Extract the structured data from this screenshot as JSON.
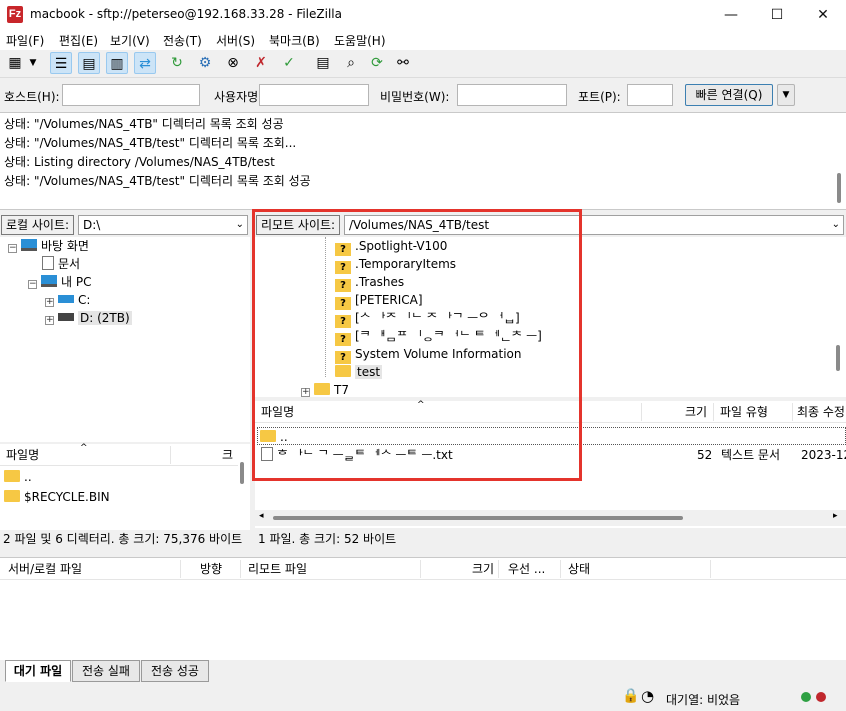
{
  "window": {
    "app_icon_text": "Fz",
    "title": "macbook - sftp://peterseo@192.168.33.28 - FileZilla",
    "minimize": "—",
    "maximize": "☐",
    "close": "✕"
  },
  "menu": [
    "파일(F)",
    "편집(E)",
    "보기(V)",
    "전송(T)",
    "서버(S)",
    "북마크(B)",
    "도움말(H)"
  ],
  "toolbar_icons": [
    "site-manager-icon",
    "dropdown-icon",
    "toggle-log-icon",
    "toggle-local-tree-icon",
    "toggle-remote-tree-icon",
    "toggle-queue-icon",
    "refresh-icon",
    "process-queue-icon",
    "cancel-icon",
    "disconnect-icon",
    "reconnect-icon",
    "filter-icon",
    "search-files-icon",
    "sync-browse-icon",
    "compare-icon"
  ],
  "quickconnect": {
    "host_label": "호스트(H):",
    "user_label": "사용자명(U):",
    "pass_label": "비밀번호(W):",
    "port_label": "포트(P):",
    "connect_button": "빠른 연결(Q)",
    "host_value": "",
    "user_value": "",
    "pass_value": "",
    "port_value": ""
  },
  "log": [
    "상태: \"/Volumes/NAS_4TB\" 디렉터리 목록 조회 성공",
    "상태: \"/Volumes/NAS_4TB/test\" 디렉터리 목록 조회...",
    "상태: Listing directory /Volumes/NAS_4TB/test",
    "상태: \"/Volumes/NAS_4TB/test\" 디렉터리 목록 조회 성공"
  ],
  "local": {
    "site_label": "로컬 사이트:",
    "path": "D:\\",
    "tree": {
      "desktop": "바탕 화면",
      "documents": "문서",
      "mypc": "내 PC",
      "c": "C:",
      "d": "D: (2TB)"
    },
    "col_name": "파일명",
    "col_size_abbr": "크",
    "files": [
      "..",
      "$RECYCLE.BIN"
    ],
    "status": "2 파일 및 6 디렉터리. 총 크기: 75,376 바이트"
  },
  "remote": {
    "site_label": "리모트 사이트:",
    "path": "/Volumes/NAS_4TB/test",
    "tree": [
      {
        "name": ".Spotlight-V100",
        "icon": "unknown-folder"
      },
      {
        "name": ".TemporaryItems",
        "icon": "unknown-folder"
      },
      {
        "name": ".Trashes",
        "icon": "unknown-folder"
      },
      {
        "name": "[PETERICA]",
        "icon": "unknown-folder"
      },
      {
        "name": "[ᄉ ᅡᄌ ᅵᄂ ᄌ ᅡᄀ ᅳᄋ ᅥᆸ]",
        "icon": "unknown-folder"
      },
      {
        "name": "[ᄏ ᅢᆷᄑ ᅵᆼᄏ ᅥᄂ ᄐ ᅦᆫᄎ ᅳ]",
        "icon": "unknown-folder"
      },
      {
        "name": "System Volume Information",
        "icon": "unknown-folder"
      },
      {
        "name": "test",
        "icon": "folder"
      },
      {
        "name": "T7",
        "icon": "folder"
      }
    ],
    "columns": {
      "name": "파일명",
      "size": "크기",
      "type": "파일 유형",
      "modified": "최종 수정"
    },
    "files": [
      {
        "name": "..",
        "size": "",
        "type": "",
        "modified": ""
      },
      {
        "name": "ᄒ ᅡᄂ ᄀ ᅳᆯᄐ ᅦᄉ ᅳᄐ ᅳ.txt",
        "size": "52",
        "type": "텍스트 문서",
        "modified": "2023-12"
      }
    ],
    "status": "1 파일. 총 크기: 52 바이트"
  },
  "queue": {
    "columns": {
      "server_file": "서버/로컬 파일",
      "direction": "방향",
      "remote_file": "리모트 파일",
      "size": "크기",
      "priority": "우선 ...",
      "status": "상태"
    },
    "tabs": [
      "대기 파일",
      "전송 실패",
      "전송 성공"
    ],
    "status_text": "대기열: 비었음"
  },
  "colors": {
    "highlight": "#e4342c",
    "accent": "#3c7fb1"
  }
}
